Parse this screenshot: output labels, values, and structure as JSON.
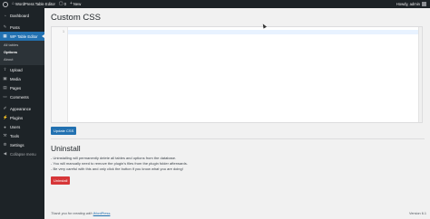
{
  "admin_bar": {
    "site_name": "WordPress Table Editor",
    "comments_count": "0",
    "new_label": "New",
    "greeting": "Howdy, admin"
  },
  "sidebar": {
    "items": [
      {
        "label": "Dashboard",
        "icon": "dashboard-icon"
      },
      {
        "label": "Posts",
        "icon": "pin-icon"
      },
      {
        "label": "WP Table Editor",
        "icon": "table-icon"
      }
    ],
    "submenu": [
      {
        "label": "All tables"
      },
      {
        "label": "Options"
      },
      {
        "label": "About"
      }
    ],
    "items_after": [
      {
        "label": "Upload",
        "icon": "upload-icon"
      },
      {
        "label": "Media",
        "icon": "media-icon"
      },
      {
        "label": "Pages",
        "icon": "page-icon"
      },
      {
        "label": "Comments",
        "icon": "comment-icon"
      },
      {
        "label": "Appearance",
        "icon": "brush-icon"
      },
      {
        "label": "Plugins",
        "icon": "plugin-icon"
      },
      {
        "label": "Users",
        "icon": "user-icon"
      },
      {
        "label": "Tools",
        "icon": "wrench-icon"
      },
      {
        "label": "Settings",
        "icon": "settings-icon"
      },
      {
        "label": "Collapse menu",
        "icon": "collapse-icon"
      }
    ]
  },
  "main": {
    "title": "Custom CSS",
    "editor_line_number": "1",
    "update_button": "Update CSS",
    "uninstall_title": "Uninstall",
    "notes": [
      "- Uninstalling will permanently delete all tables and options from the database.",
      "- You will manually need to remove the plugin's files from the plugin folder afterwards.",
      "- Be very careful with this and only click the button if you know what you are doing!"
    ],
    "uninstall_button": "Uninstall"
  },
  "footer": {
    "thanks_prefix": "Thank you for creating with",
    "thanks_link": "WordPress",
    "version": "Version 6.1"
  },
  "colors": {
    "admin_dark": "#1d2327",
    "accent": "#2271b1",
    "danger": "#d63638"
  }
}
